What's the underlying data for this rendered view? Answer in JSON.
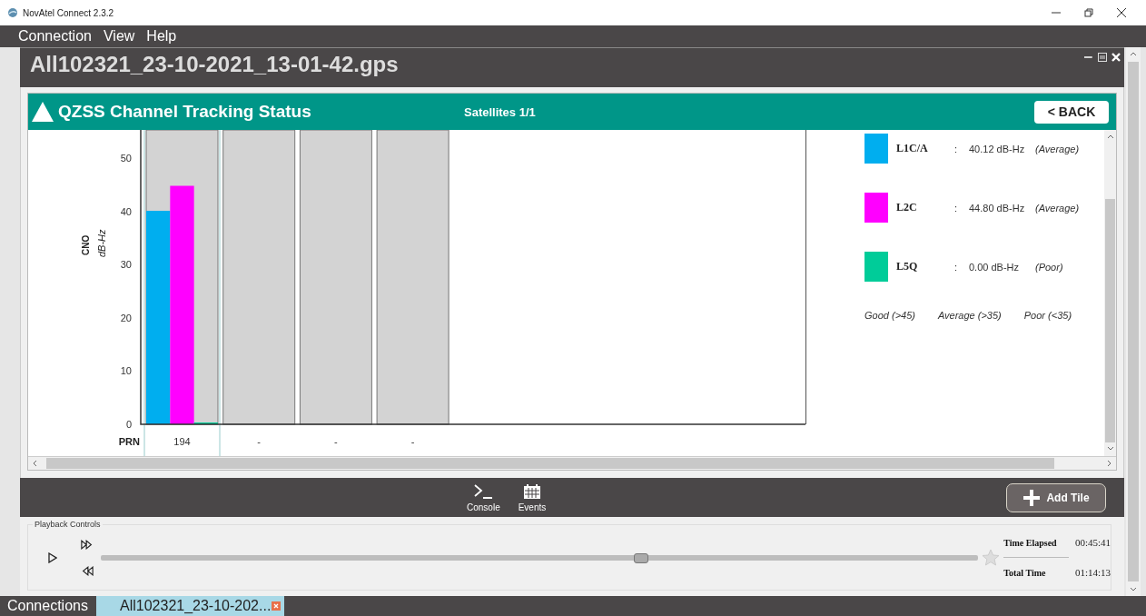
{
  "window": {
    "title": "NovAtel Connect 2.3.2"
  },
  "menu": [
    "Connection",
    "View",
    "Help"
  ],
  "document": {
    "title": "All102321_23-10-2021_13-01-42.gps"
  },
  "tile": {
    "title": "QZSS Channel Tracking Status",
    "satellites": "Satellites 1/1",
    "back_button": "< BACK",
    "y_unit": "dB-Hz",
    "chart_data": {
      "type": "bar",
      "xlabel": "PRN",
      "ylabel": "CNO",
      "categories": [
        "194",
        "-",
        "-",
        "-"
      ],
      "ylim": [
        0,
        55.3
      ],
      "yticks": [
        0,
        10,
        20,
        30,
        40,
        50
      ],
      "series": [
        {
          "name": "L1C/A",
          "color": "#00aeef",
          "values": [
            40.1,
            null,
            null,
            null
          ]
        },
        {
          "name": "L2C",
          "color": "#ff00ff",
          "values": [
            44.8,
            null,
            null,
            null
          ]
        },
        {
          "name": "L5Q",
          "color": "#00cc99",
          "values": [
            0,
            null,
            null,
            null
          ]
        }
      ]
    },
    "legend": [
      {
        "separator": ":",
        "reading": "40.12 dB-Hz",
        "quality": "(Average)"
      },
      {
        "separator": ":",
        "reading": "44.80 dB-Hz",
        "quality": "(Average)"
      },
      {
        "separator": ":",
        "reading": "0.00 dB-Hz",
        "quality": "(Poor)"
      }
    ],
    "quality_scale": [
      "Good (>45)",
      "Average (>35)",
      "Poor (<35)"
    ]
  },
  "toolbar": {
    "buttons": [
      {
        "label": "Console",
        "kind": "console"
      },
      {
        "label": "Events",
        "kind": "events"
      }
    ],
    "add_tile": "Add Tile"
  },
  "playback": {
    "title": "Playback Controls",
    "level": 0.615,
    "time_elapsed_label": "Time Elapsed",
    "time_elapsed": "00:45:41",
    "total_time_label": "Total Time",
    "total_time": "01:14:13"
  },
  "taskbar": {
    "label": "Connections",
    "tabs": [
      {
        "label": "All102321_23-10-202...",
        "selected": true
      }
    ]
  }
}
